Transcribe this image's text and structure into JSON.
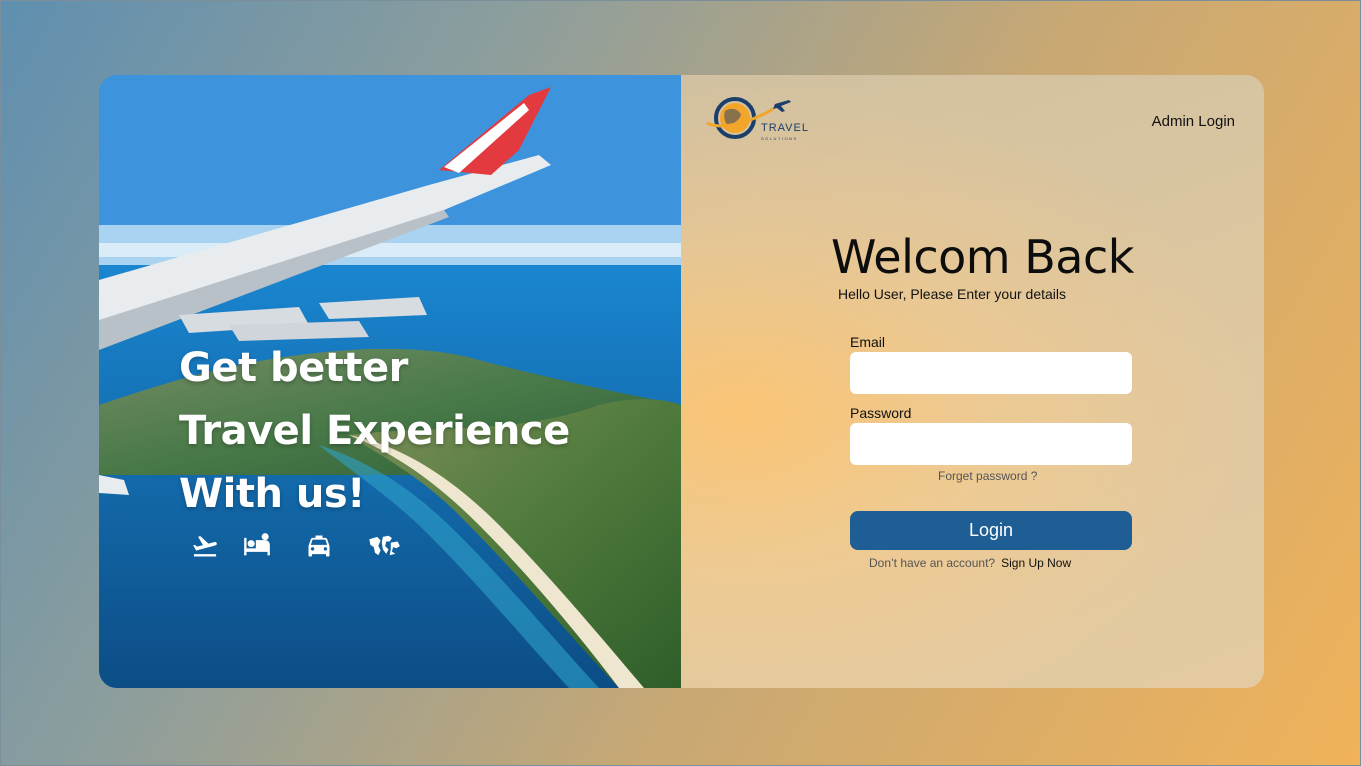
{
  "hero": {
    "lines": [
      "Get better",
      "Travel Experience",
      "With us!"
    ],
    "icons": [
      "flight-takeoff-icon",
      "hotel-bed-icon",
      "taxi-icon",
      "world-map-icon"
    ]
  },
  "brand": {
    "logo_text": "TRAVEL",
    "logo_subtext": "SOLUTIONS"
  },
  "header": {
    "admin_login": "Admin Login"
  },
  "form": {
    "title": "Welcom Back",
    "subtitle": "Hello User, Please Enter your details",
    "email_label": "Email",
    "email_value": "",
    "password_label": "Password",
    "password_value": "",
    "forgot_password": "Forget password ?",
    "login_button": "Login",
    "no_account_text": "Don’t  have an account?",
    "signup_link": "Sign Up Now"
  },
  "colors": {
    "button": "#1e5e94",
    "brand_blue": "#1b3f6b",
    "brand_orange": "#f2a52b"
  }
}
